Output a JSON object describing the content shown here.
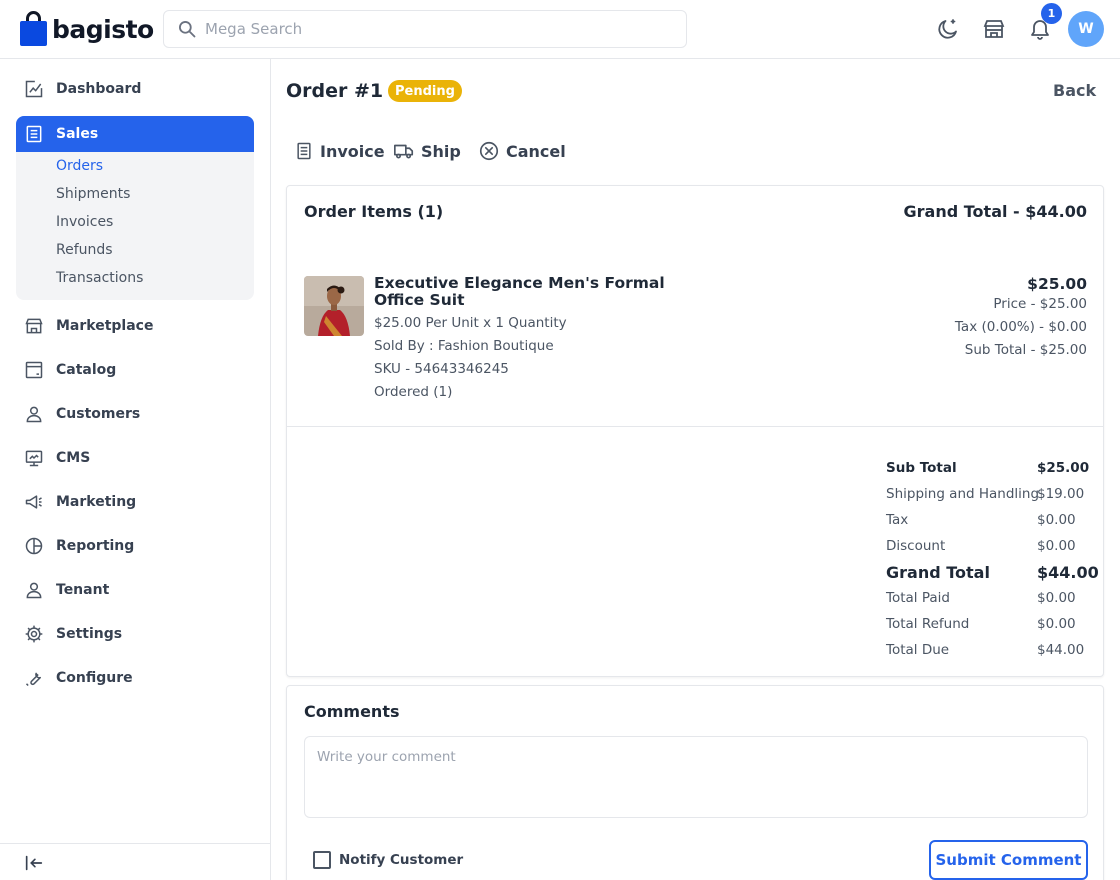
{
  "header": {
    "logo_text": "bagisto",
    "search_placeholder": "Mega Search",
    "notification_count": "1",
    "avatar_initial": "W",
    "icons": [
      "search-icon",
      "dark-mode-icon",
      "store-icon",
      "bell-icon"
    ]
  },
  "sidebar": {
    "items": [
      {
        "label": "Dashboard",
        "icon": "dashboard-icon"
      },
      {
        "label": "Sales",
        "icon": "sales-icon"
      },
      {
        "label": "Marketplace",
        "icon": "marketplace-icon"
      },
      {
        "label": "Catalog",
        "icon": "catalog-icon"
      },
      {
        "label": "Customers",
        "icon": "customers-icon"
      },
      {
        "label": "CMS",
        "icon": "cms-icon"
      },
      {
        "label": "Marketing",
        "icon": "marketing-icon"
      },
      {
        "label": "Reporting",
        "icon": "reporting-icon"
      },
      {
        "label": "Tenant",
        "icon": "tenant-icon"
      },
      {
        "label": "Settings",
        "icon": "settings-icon"
      },
      {
        "label": "Configure",
        "icon": "configure-icon"
      }
    ],
    "sales_submenu": [
      "Orders",
      "Shipments",
      "Invoices",
      "Refunds",
      "Transactions"
    ],
    "active_item": "Sales",
    "active_subitem": "Orders"
  },
  "order": {
    "title": "Order #1",
    "status": "Pending",
    "back_label": "Back",
    "actions": [
      {
        "label": "Invoice",
        "icon": "invoice-icon"
      },
      {
        "label": "Ship",
        "icon": "truck-icon"
      },
      {
        "label": "Cancel",
        "icon": "cancel-icon"
      }
    ]
  },
  "items_card": {
    "heading": "Order Items (1)",
    "grand_total_heading": "Grand Total - $44.00",
    "product": {
      "name": "Executive Elegance Men's Formal Office Suit",
      "unit_line": "$25.00 Per Unit x 1 Quantity",
      "sold_by": "Sold By : Fashion Boutique",
      "sku": "SKU - 54643346245",
      "ordered": "Ordered (1)",
      "total": "$25.00",
      "price_line": "Price - $25.00",
      "tax_line": "Tax (0.00%) - $0.00",
      "subtotal_line": "Sub Total - $25.00"
    },
    "summary": [
      {
        "label": "Sub Total",
        "value": "$25.00"
      },
      {
        "label": "Shipping and Handling",
        "value": "$19.00"
      },
      {
        "label": "Tax",
        "value": "$0.00"
      },
      {
        "label": "Discount",
        "value": "$0.00"
      },
      {
        "label": "Grand Total",
        "value": "$44.00"
      },
      {
        "label": "Total Paid",
        "value": "$0.00"
      },
      {
        "label": "Total Refund",
        "value": "$0.00"
      },
      {
        "label": "Total Due",
        "value": "$44.00"
      }
    ]
  },
  "comments": {
    "heading": "Comments",
    "placeholder": "Write your comment",
    "value": "",
    "notify_label": "Notify Customer",
    "notify_checked": false,
    "submit_label": "Submit Comment"
  },
  "colors": {
    "primary": "#2563eb",
    "status_pending": "#eab308",
    "avatar": "#60a5fa"
  }
}
